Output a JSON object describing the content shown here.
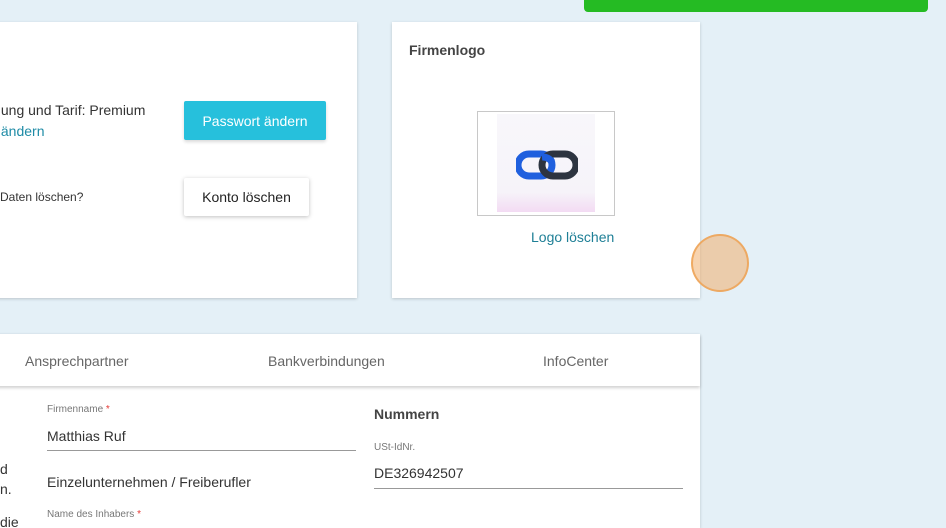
{
  "account": {
    "plan_text": "alung und Tarif: Premium",
    "change_link": "if ändern",
    "password_button": "Passwort ändern",
    "delete_question": "e Daten löschen?",
    "delete_button": "Konto löschen"
  },
  "logo_card": {
    "title": "Firmenlogo",
    "delete_link": "Logo löschen",
    "logo_icon": "chain-link-icon"
  },
  "tabs": [
    {
      "label": "Ansprechpartner"
    },
    {
      "label": "Bankverbindungen"
    },
    {
      "label": "InfoCenter"
    }
  ],
  "form": {
    "company_name_label": "Firmenname",
    "company_name_value": "Matthias Ruf",
    "company_type": "Einzelunternehmen / Freiberufler",
    "owner_label": "Name des Inhabers",
    "required_mark": "*",
    "left_fragments": [
      "d",
      "n.",
      "die"
    ],
    "numbers_title": "Nummern",
    "vat_label": "USt-IdNr.",
    "vat_value": "DE326942507"
  },
  "colors": {
    "accent": "#26c0dc",
    "link": "#1e8ba6",
    "success_bar": "#25bb23",
    "background": "#e4f0f7"
  }
}
